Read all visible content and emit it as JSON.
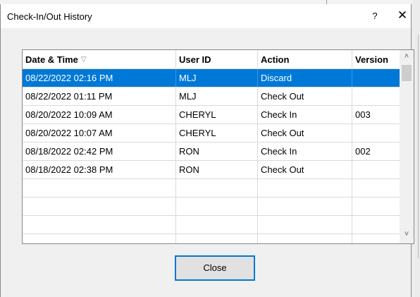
{
  "window": {
    "title": "Check-In/Out History",
    "help_label": "?",
    "close_label": "✕"
  },
  "table": {
    "columns": [
      "Date & Time",
      "User ID",
      "Action",
      "Version"
    ],
    "sort_indicator": "▽",
    "rows": [
      {
        "date_time": "08/22/2022 02:16 PM",
        "user_id": "MLJ",
        "action": "Discard",
        "version": ""
      },
      {
        "date_time": "08/22/2022 01:11 PM",
        "user_id": "MLJ",
        "action": "Check Out",
        "version": ""
      },
      {
        "date_time": "08/20/2022 10:09 AM",
        "user_id": "CHERYL",
        "action": "Check In",
        "version": "003"
      },
      {
        "date_time": "08/20/2022 10:07 AM",
        "user_id": "CHERYL",
        "action": "Check Out",
        "version": ""
      },
      {
        "date_time": "08/18/2022  02:42 PM",
        "user_id": "RON",
        "action": "Check In",
        "version": "002"
      },
      {
        "date_time": "08/18/2022  02:38 PM",
        "user_id": "RON",
        "action": "Check Out",
        "version": ""
      }
    ],
    "selected_row": 0
  },
  "scrollbar": {
    "up_glyph": "˄",
    "down_glyph": "˅"
  },
  "buttons": {
    "close_label": "Close"
  },
  "colors": {
    "selection": "#0078d7",
    "focus_border": "#0078d7"
  }
}
